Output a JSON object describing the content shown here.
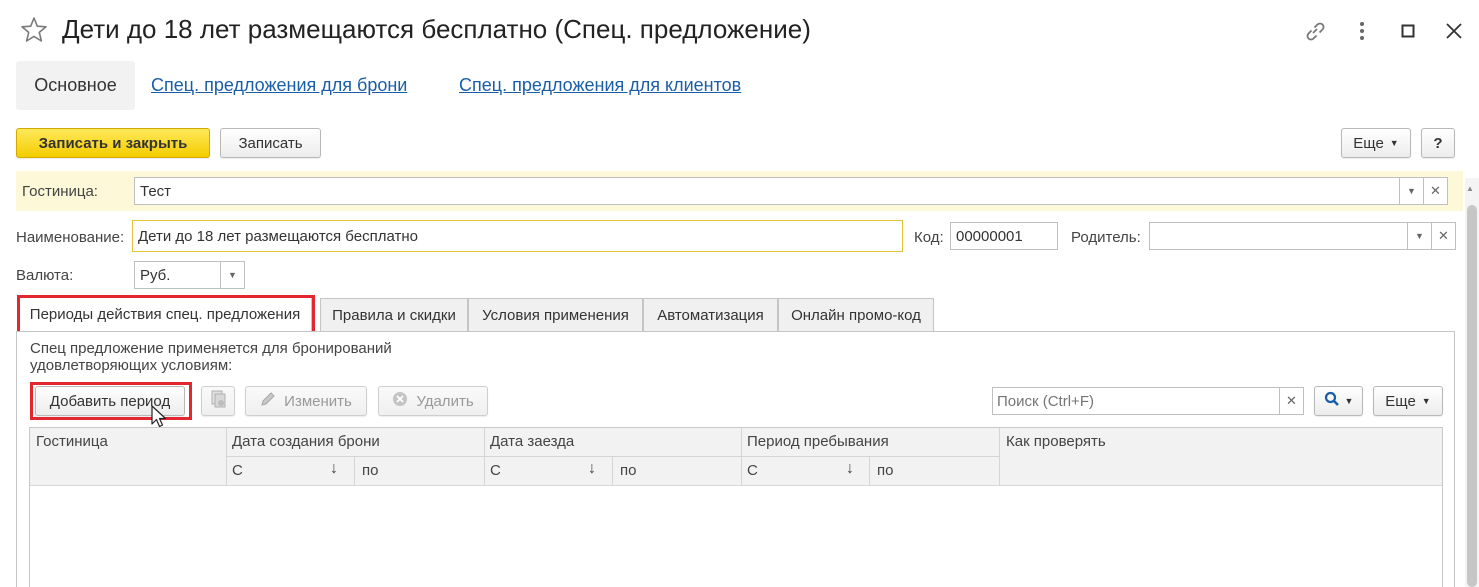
{
  "window": {
    "title": "Дети до 18 лет размещаются бесплатно (Спец. предложение)"
  },
  "nav": {
    "main": "Основное",
    "link1": "Спец. предложения для брони",
    "link2": "Спец. предложения для клиентов"
  },
  "toolbar": {
    "save_close": "Записать и закрыть",
    "save": "Записать",
    "more": "Еще",
    "help": "?"
  },
  "form": {
    "hotel_label": "Гостиница:",
    "hotel_value": "Тест",
    "name_label": "Наименование:",
    "name_value": "Дети до 18 лет размещаются бесплатно",
    "code_label": "Код:",
    "code_value": "00000001",
    "parent_label": "Родитель:",
    "parent_value": "",
    "currency_label": "Валюта:",
    "currency_value": "Руб."
  },
  "tabs": [
    {
      "label": "Периоды действия спец. предложения"
    },
    {
      "label": "Правила и скидки"
    },
    {
      "label": "Условия применения"
    },
    {
      "label": "Автоматизация"
    },
    {
      "label": "Онлайн промо-код"
    }
  ],
  "panel": {
    "description": "Спец предложение применяется для бронирований удовлетворяющих условиям:",
    "add_period": "Добавить период",
    "edit": "Изменить",
    "delete": "Удалить",
    "search_placeholder": "Поиск (Ctrl+F)",
    "more": "Еще"
  },
  "table": {
    "col_hotel": "Гостиница",
    "col_booking_date": "Дата создания брони",
    "col_checkin": "Дата заезда",
    "col_stay": "Период пребывания",
    "col_check": "Как проверять",
    "from": "С",
    "to": "по"
  },
  "colors": {
    "accent_yellow": "#f4cd00",
    "link_blue": "#1a5ea8",
    "highlight_red": "#e3262f",
    "hotel_band": "#fdf8d8"
  }
}
